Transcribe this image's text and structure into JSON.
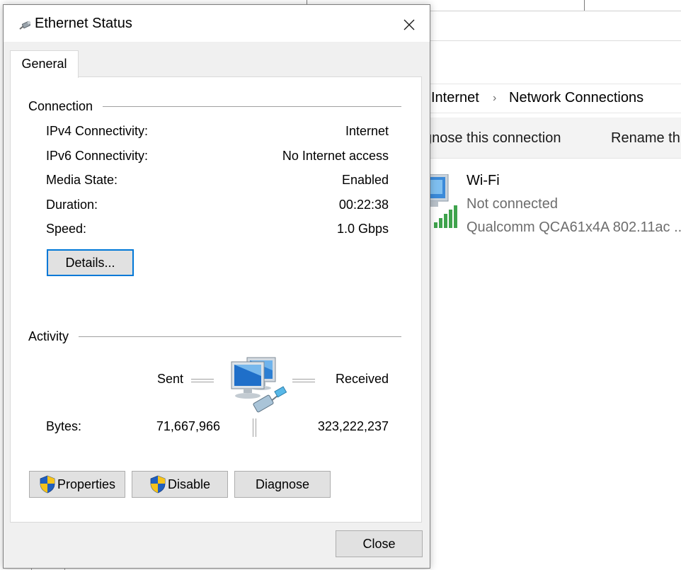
{
  "dialog": {
    "title": "Ethernet Status",
    "tab_general": "General",
    "connection": {
      "group_label": "Connection",
      "rows": [
        {
          "label": "IPv4 Connectivity:",
          "value": "Internet"
        },
        {
          "label": "IPv6 Connectivity:",
          "value": "No Internet access"
        },
        {
          "label": "Media State:",
          "value": "Enabled"
        },
        {
          "label": "Duration:",
          "value": "00:22:38"
        },
        {
          "label": "Speed:",
          "value": "1.0 Gbps"
        }
      ],
      "details_button": "Details..."
    },
    "activity": {
      "group_label": "Activity",
      "sent_label": "Sent",
      "received_label": "Received",
      "bytes_label": "Bytes:",
      "bytes_sent": "71,667,966",
      "bytes_received": "323,222,237"
    },
    "buttons": {
      "properties": "Properties",
      "disable": "Disable",
      "diagnose": "Diagnose",
      "close": "Close"
    },
    "icons": {
      "title": "ethernet-cable-icon",
      "close": "close-icon",
      "activity": "network-computers-icon",
      "shield": "uac-shield-icon"
    }
  },
  "background_window": {
    "breadcrumb": [
      "Internet",
      "Network Connections"
    ],
    "commands": [
      "gnose this connection",
      "Rename th"
    ],
    "connection_item": {
      "name": "Wi-Fi",
      "status": "Not connected",
      "adapter": "Qualcomm QCA61x4A 802.11ac ..."
    }
  },
  "colors": {
    "dialog_bg": "#f0f0f0",
    "panel_bg": "#ffffff",
    "focus_border": "#0078d7",
    "button_bg": "#e1e1e1",
    "wifi_signal": "#3fa34d"
  }
}
